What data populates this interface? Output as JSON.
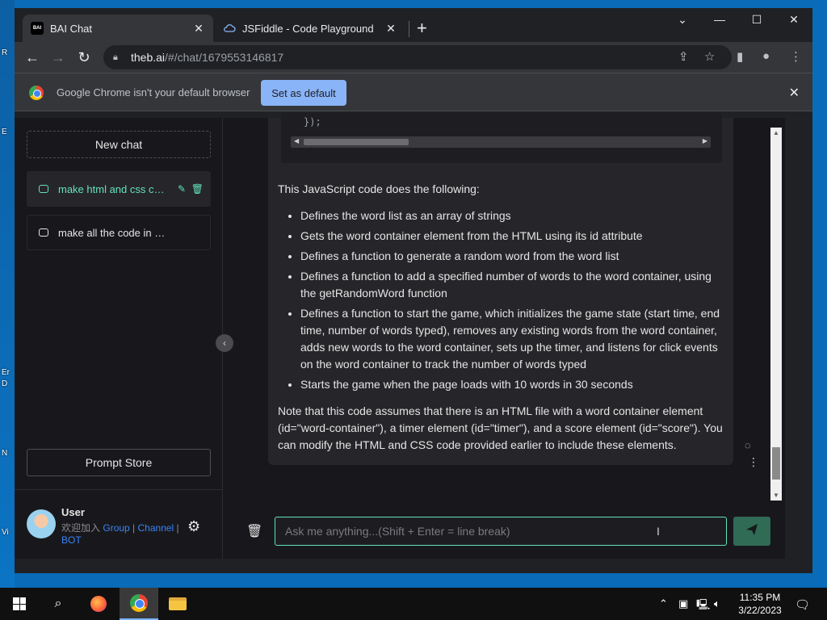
{
  "desktop": {
    "edge_labels": [
      "R",
      "E",
      "Er",
      "D",
      "N",
      "Vi"
    ]
  },
  "browser": {
    "tabs": [
      {
        "title": "BAI Chat",
        "favicon": "BAI"
      },
      {
        "title": "JSFiddle - Code Playground"
      }
    ],
    "url_host": "theb.ai",
    "url_path": "/#/chat/1679553146817",
    "infobar": {
      "message": "Google Chrome isn't your default browser",
      "button": "Set as default"
    }
  },
  "sidebar": {
    "new_chat": "New chat",
    "chats": [
      {
        "label": "make html and css code for a typing game"
      },
      {
        "label": "make all the code in one single file"
      }
    ],
    "prompt_store": "Prompt Store",
    "user": {
      "name": "User",
      "desc_prefix": "欢迎加入",
      "link_group": "Group",
      "sep1": " | ",
      "link_channel": "Channel",
      "sep2": " | ",
      "link_bot": "BOT"
    }
  },
  "message": {
    "code_fragment": "});",
    "intro": "This JavaScript code does the following:",
    "bullets": [
      "Defines the word list as an array of strings",
      "Gets the word container element from the HTML using its id attribute",
      "Defines a function to generate a random word from the word list",
      "Defines a function to add a specified number of words to the word container, using the getRandomWord function",
      "Defines a function to start the game, which initializes the game state (start time, end time, number of words typed), removes any existing words from the word container, adds new words to the word container, sets up the timer, and listens for click events on the word container to track the number of words typed",
      "Starts the game when the page loads with 10 words in 30 seconds"
    ],
    "note": "Note that this code assumes that there is an HTML file with a word container element (id=\"word-container\"), a timer element (id=\"timer\"), and a score element (id=\"score\"). You can modify the HTML and CSS code provided earlier to include these elements."
  },
  "input": {
    "placeholder": "Ask me anything...(Shift + Enter = line break)"
  },
  "taskbar": {
    "time": "11:35 PM",
    "date": "3/22/2023"
  },
  "colors": {
    "accent": "#63e2b7",
    "link": "#3b82f6",
    "infobar_button": "#8ab4f8"
  }
}
